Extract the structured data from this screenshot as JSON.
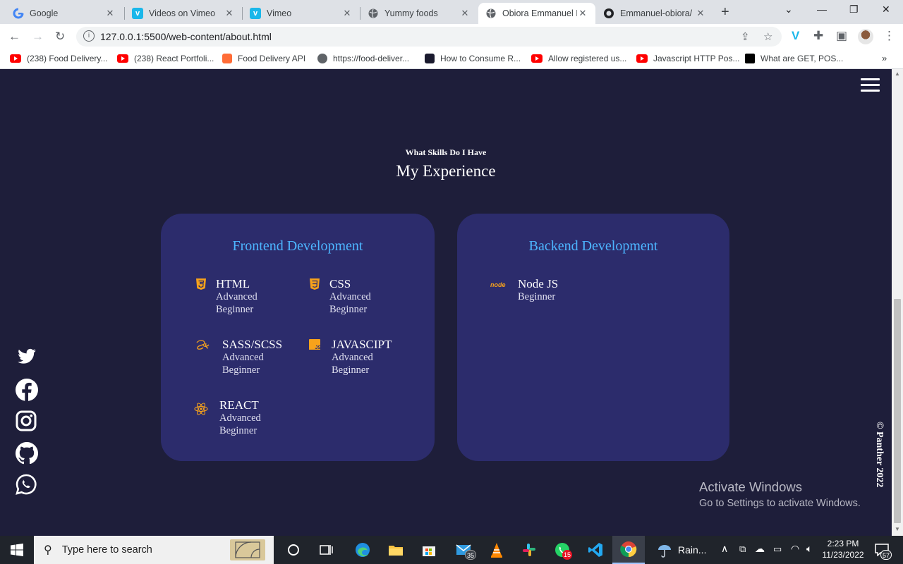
{
  "browser": {
    "tabs": [
      {
        "title": "Google",
        "icon": "google-icon",
        "active": false
      },
      {
        "title": "Videos on Vimeo",
        "icon": "vimeo-icon",
        "active": false
      },
      {
        "title": "Vimeo",
        "icon": "vimeo-icon",
        "active": false
      },
      {
        "title": "Yummy foods",
        "icon": "globe-icon",
        "active": false
      },
      {
        "title": "Obiora Emmanuel I",
        "icon": "globe-icon",
        "active": true
      },
      {
        "title": "Emmanuel-obiora/",
        "icon": "github-icon",
        "active": false
      }
    ],
    "address": "127.0.0.1:5500/web-content/about.html",
    "bookmarks": [
      {
        "label": "(238) Food Delivery...",
        "icon": "youtube-icon"
      },
      {
        "label": "(238) React Portfoli...",
        "icon": "youtube-icon"
      },
      {
        "label": "Food Delivery API",
        "icon": "postman-icon"
      },
      {
        "label": "https://food-deliver...",
        "icon": "globe-icon"
      },
      {
        "label": "How to Consume R...",
        "icon": "dev-icon"
      },
      {
        "label": "Allow registered us...",
        "icon": "youtube-icon"
      },
      {
        "label": "Javascript HTTP Pos...",
        "icon": "youtube-icon"
      },
      {
        "label": "What are GET, POS...",
        "icon": "medium-icon"
      }
    ]
  },
  "section": {
    "subtitle": "What Skills Do I Have",
    "title": "My Experience"
  },
  "frontend": {
    "title": "Frontend Development",
    "skills": [
      {
        "name": "HTML",
        "level": "Advanced Beginner",
        "icon": "html5-icon"
      },
      {
        "name": "CSS",
        "level": "Advanced Beginner",
        "icon": "css3-icon"
      },
      {
        "name": "SASS/SCSS",
        "level": "Advanced Beginner",
        "icon": "sass-icon"
      },
      {
        "name": "JAVASCIPT",
        "level": "Advanced Beginner",
        "icon": "javascript-icon"
      },
      {
        "name": "REACT",
        "level": "Advanced Beginner",
        "icon": "react-icon"
      }
    ]
  },
  "backend": {
    "title": "Backend Development",
    "skills": [
      {
        "name": "Node JS",
        "level": "Beginner",
        "icon": "nodejs-icon"
      }
    ]
  },
  "socials": [
    "twitter-icon",
    "facebook-icon",
    "instagram-icon",
    "github-icon",
    "whatsapp-icon"
  ],
  "footer": {
    "copyright": "© Panther 2022"
  },
  "watermark": {
    "line1": "Activate Windows",
    "line2": "Go to Settings to activate Windows."
  },
  "taskbar": {
    "search_placeholder": "Type here to search",
    "weather": "Rain...",
    "time": "2:23 PM",
    "date": "11/23/2022",
    "mail_badge": "35",
    "whatsapp_badge": "15",
    "notification_count": "57"
  },
  "colors": {
    "page_bg": "#1e1e3a",
    "card_bg": "#2c2c6c",
    "accent": "#4db5ff",
    "icon_orange": "#f7a21b"
  }
}
